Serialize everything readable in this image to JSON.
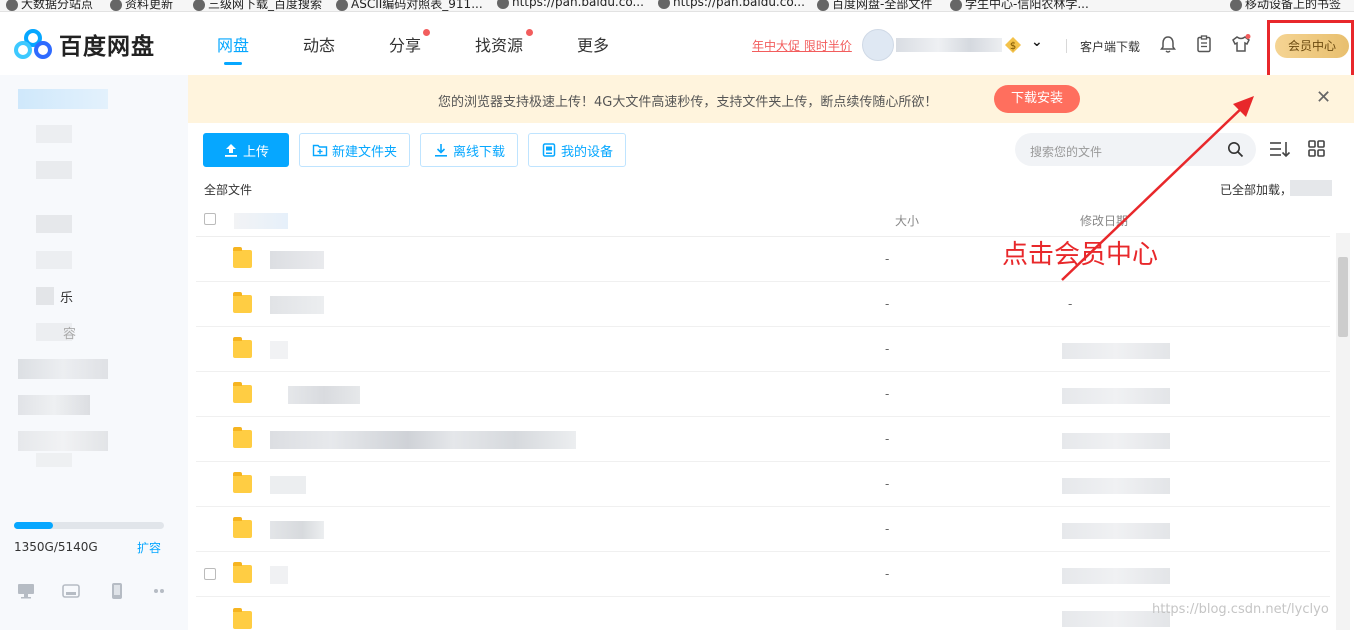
{
  "colors": {
    "accent": "#06a7ff",
    "promo_red": "#f25d5d",
    "annotation_red": "#e8282b",
    "banner_bg": "#fff4dd",
    "download_btn": "#ff6f5e"
  },
  "bookmarks": [
    "大数据分站点",
    "资料更新",
    "三级网下载_百度搜索",
    "ASCII编码对照表_911...",
    "https://pan.baidu.co...",
    "https://pan.baidu.co...",
    "百度网盘-全部文件",
    "学生中心-信阳农林学...",
    "移动设备上的书签"
  ],
  "header": {
    "logo_text": "百度网盘",
    "nav": [
      {
        "label": "网盘",
        "active": true,
        "dot": false
      },
      {
        "label": "动态",
        "active": false,
        "dot": false
      },
      {
        "label": "分享",
        "active": false,
        "dot": true
      },
      {
        "label": "找资源",
        "active": false,
        "dot": true
      },
      {
        "label": "更多",
        "active": false,
        "dot": false
      }
    ],
    "promo": "年中大促 限时半价",
    "client_download": "客户端下载",
    "icons": [
      "bell-icon",
      "clipboard-icon",
      "shirt-icon"
    ],
    "vip_button": "会员中心"
  },
  "banner": {
    "text": "您的浏览器支持极速上传！4G大文件高速秒传，支持文件夹上传，断点续传随心所欲！",
    "download_button": "下载安装",
    "close": "✕"
  },
  "sidebar": {
    "partial_labels": [
      "乐",
      "容"
    ],
    "storage_text": "1350G/5140G",
    "storage_fraction": 0.26,
    "expand": "扩容",
    "device_icons": [
      "pc-icon",
      "mac-icon",
      "phone-icon",
      "more-icon"
    ]
  },
  "toolbar": {
    "upload": "上传",
    "new_folder": "新建文件夹",
    "offline_download": "离线下载",
    "my_devices": "我的设备",
    "search_placeholder": "搜索您的文件"
  },
  "breadcrumb": "全部文件",
  "loaded_text": "已全部加载，",
  "table": {
    "headers": {
      "size": "大小",
      "modified": "修改日期"
    },
    "rows": [
      {
        "size": "-",
        "date": ""
      },
      {
        "size": "-",
        "date": "-"
      },
      {
        "size": "-",
        "date": ""
      },
      {
        "size": "-",
        "date": ""
      },
      {
        "size": "-",
        "date": ""
      },
      {
        "size": "-",
        "date": ""
      },
      {
        "size": "-",
        "date": ""
      },
      {
        "size": "-",
        "date": ""
      }
    ]
  },
  "annotation": "点击会员中心",
  "watermark": "https://blog.csdn.net/lyclyo"
}
